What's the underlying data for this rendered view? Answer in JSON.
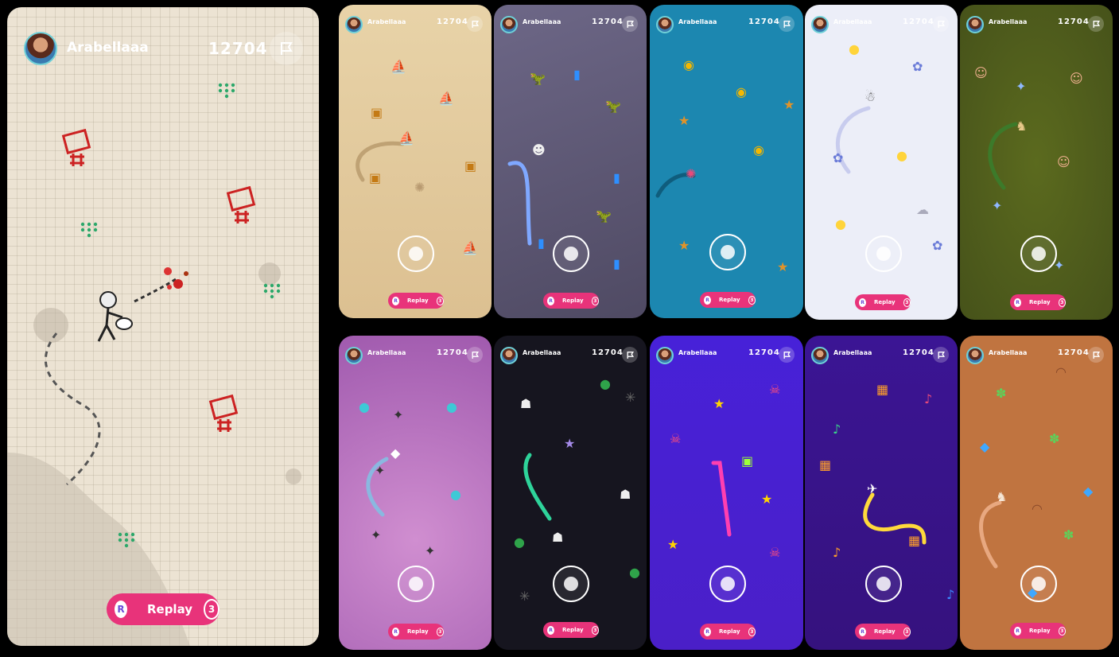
{
  "player": {
    "name": "Arabellaaa",
    "score": "12704"
  },
  "replay": {
    "label": "Replay",
    "count": "3",
    "badge": "R"
  },
  "panels": [
    {
      "id": "main",
      "theme": "sketch-grid",
      "bg": "#ece3d3"
    },
    {
      "id": "p1",
      "theme": "pirate-sand",
      "bg": "#e6cfa0"
    },
    {
      "id": "p2",
      "theme": "dino-night",
      "bg": "#5c5670"
    },
    {
      "id": "p3",
      "theme": "ocean-waves",
      "bg": "#1c87b0"
    },
    {
      "id": "p4",
      "theme": "snow",
      "bg": "#eceef8"
    },
    {
      "id": "p5",
      "theme": "grassland",
      "bg": "#56621c"
    },
    {
      "id": "p6",
      "theme": "candy-pink",
      "bg": "#b56cc0"
    },
    {
      "id": "p7",
      "theme": "ghost-dark",
      "bg": "#16151f"
    },
    {
      "id": "p8",
      "theme": "neon-purple",
      "bg": "#4a1fd6"
    },
    {
      "id": "p9",
      "theme": "music-purple",
      "bg": "#3a1594"
    },
    {
      "id": "p10",
      "theme": "desert-clay",
      "bg": "#c07440"
    }
  ]
}
